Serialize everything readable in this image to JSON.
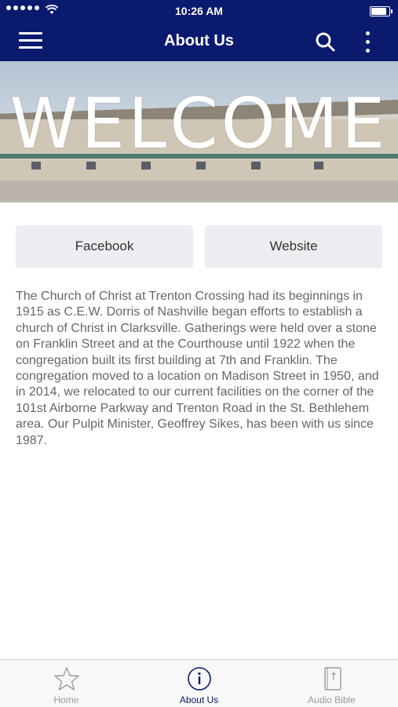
{
  "status_bar": {
    "time": "10:26 AM",
    "battery_level": 0.95
  },
  "nav": {
    "title": "About Us",
    "menu_icon": "hamburger-menu-icon",
    "search_icon": "search-icon",
    "more_icon": "more-vertical-icon"
  },
  "banner": {
    "text": "WELCOME"
  },
  "buttons": {
    "facebook": "Facebook",
    "website": "Website"
  },
  "about": {
    "text": "The Church of Christ at Trenton Crossing had its beginnings in 1915 as C.E.W. Dorris of Nashville began efforts to establish a church of Christ in Clarksville. Gatherings were held over a stone on Franklin Street and at the Courthouse until 1922 when the congregation built its first building at 7th and Franklin. The congregation moved to a location on Madison Street in 1950, and in 2014, we relocated to our current facilities on the corner of the 101st Airborne Parkway and Trenton Road in the St. Bethlehem area.  Our Pulpit Minister, Geoffrey Sikes, has been with us since 1987."
  },
  "tabs": [
    {
      "label": "Home",
      "icon": "star-icon",
      "active": false
    },
    {
      "label": "About Us",
      "icon": "info-icon",
      "active": true
    },
    {
      "label": "Audio Bible",
      "icon": "bible-icon",
      "active": false
    }
  ],
  "colors": {
    "primary": "#0a1a6e",
    "text_gray": "#666666",
    "button_bg": "#eceef1",
    "tab_inactive": "#999999"
  }
}
